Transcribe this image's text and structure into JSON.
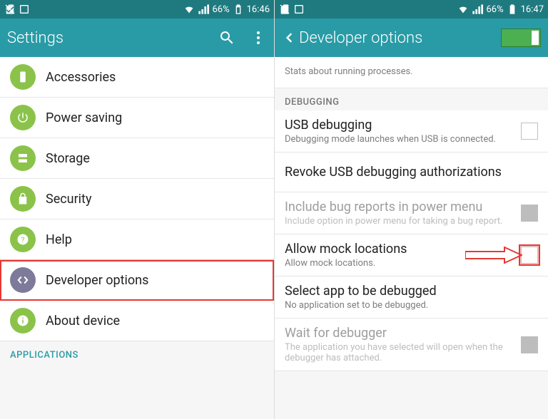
{
  "left": {
    "status": {
      "battery": "66%",
      "time": "16:46"
    },
    "title": "Settings",
    "items": [
      {
        "label": "Accessories",
        "icon": "device"
      },
      {
        "label": "Power saving",
        "icon": "power"
      },
      {
        "label": "Storage",
        "icon": "storage"
      },
      {
        "label": "Security",
        "icon": "lock"
      },
      {
        "label": "Help",
        "icon": "help"
      },
      {
        "label": "Developer options",
        "icon": "code",
        "highlight": true,
        "purple": true
      },
      {
        "label": "About device",
        "icon": "info"
      }
    ],
    "section": "APPLICATIONS"
  },
  "right": {
    "status": {
      "battery": "66%",
      "time": "16:47"
    },
    "title": "Developer options",
    "truncated_sub": "Stats about running processes.",
    "section": "DEBUGGING",
    "rows": {
      "usb": {
        "title": "USB debugging",
        "sub": "Debugging mode launches when USB is connected."
      },
      "revoke": {
        "title": "Revoke USB debugging authorizations"
      },
      "bugreport": {
        "title": "Include bug reports in power menu",
        "sub": "Include option in power menu for taking a bug report."
      },
      "mock": {
        "title": "Allow mock locations",
        "sub": "Allow mock locations."
      },
      "selectapp": {
        "title": "Select app to be debugged",
        "sub": "No application set to be debugged."
      },
      "wait": {
        "title": "Wait for debugger",
        "sub": "The application you have selected will open when the debugger has attached."
      }
    }
  }
}
